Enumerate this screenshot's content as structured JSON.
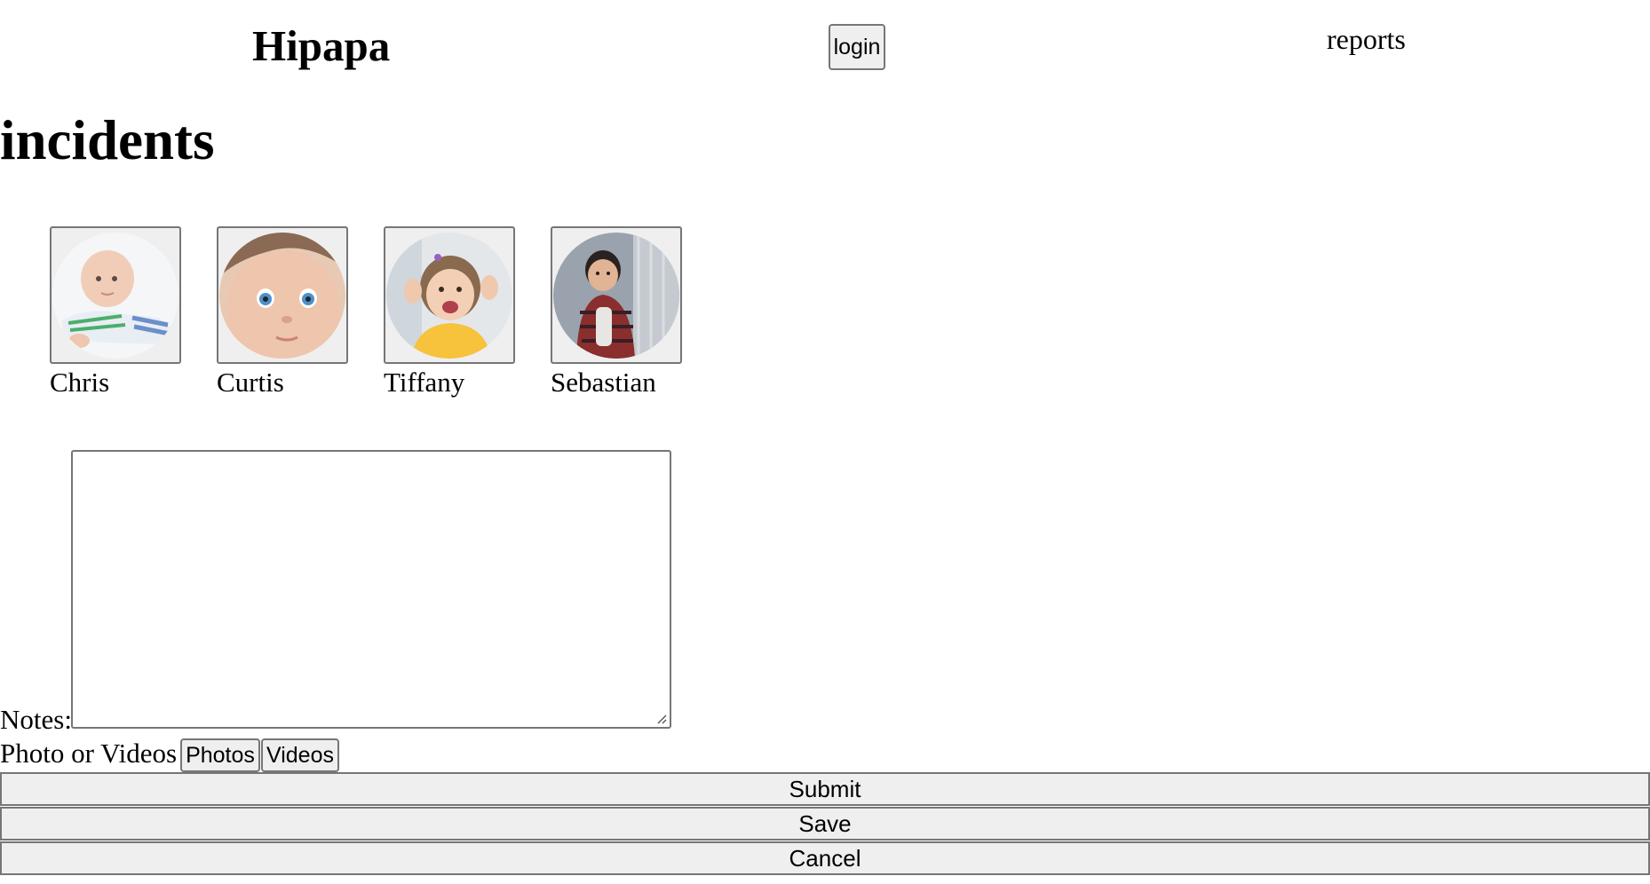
{
  "header": {
    "brand": "Hipapa",
    "login_label": "login",
    "reports_label": "reports"
  },
  "page": {
    "title": "incidents"
  },
  "children": [
    {
      "name": "Chris",
      "avatar": "baby-lying-photo"
    },
    {
      "name": "Curtis",
      "avatar": "baby-blue-eyes-photo"
    },
    {
      "name": "Tiffany",
      "avatar": "toddler-girl-waving-photo"
    },
    {
      "name": "Sebastian",
      "avatar": "toddler-boy-sitting-photo"
    }
  ],
  "form": {
    "notes_label": "Notes:",
    "notes_value": "",
    "media_label": "Photo or Videos",
    "photos_label": "Photos",
    "videos_label": "Videos",
    "submit_label": "Submit",
    "save_label": "Save",
    "cancel_label": "Cancel"
  },
  "colors": {
    "button_bg": "#efefef",
    "button_border": "#767676"
  }
}
